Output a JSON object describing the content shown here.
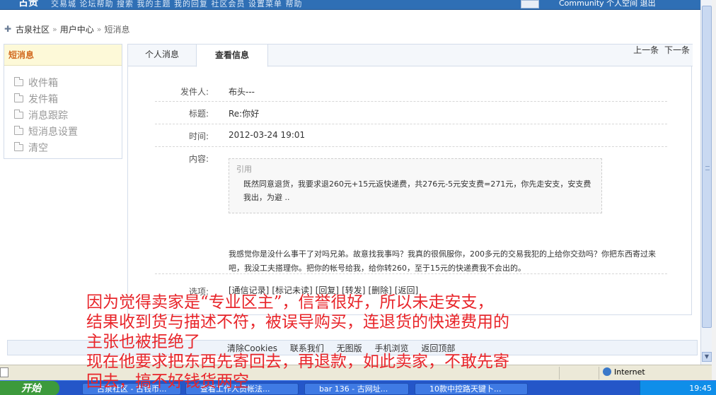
{
  "topbar": {
    "logo": "古贵",
    "nav_text": "交易城   论坛帮助   搜索   我的主题   我的回复   社区会员   设置菜单   帮助",
    "right_text": "Community   个人空间   退出"
  },
  "breadcrumb": {
    "items": [
      "古泉社区",
      "用户中心",
      "短消息"
    ]
  },
  "sidebar": {
    "title": "短消息",
    "items": [
      {
        "label": "收件箱",
        "icon": "folder-icon"
      },
      {
        "label": "发件箱",
        "icon": "folder-icon"
      },
      {
        "label": "消息跟踪",
        "icon": "folder-icon"
      },
      {
        "label": "短消息设置",
        "icon": "folder-icon"
      },
      {
        "label": "清空",
        "icon": "folder-icon"
      }
    ]
  },
  "tabs": [
    {
      "label": "个人消息",
      "active": false
    },
    {
      "label": "查看信息",
      "active": true
    }
  ],
  "pager": {
    "prev": "上一条",
    "next": "下一条"
  },
  "message": {
    "sender_label": "发件人:",
    "sender": "布头---",
    "subject_label": "标题:",
    "subject": "Re:你好",
    "time_label": "时间:",
    "time": "2012-03-24 19:01",
    "content_label": "内容:",
    "quote_title": "引用",
    "quote_body": "既然同意退货，我要求退260元+15元返快递费，共276元-5元安支费=271元，你先走安支，安支费我出，为避  ..",
    "body": "我感觉你是没什么事干了对吗兄弟。故意找我事吗？我真的很佩服你，200多元的交易我犯的上给你交劲吗？你把东西寄过来吧，我没工夫搭理你。把你的帐号给我，给你转260，至于15元的快递费我不会出的。",
    "options_label": "选项:",
    "options": [
      "[通信记录]",
      "[标记未读]",
      "[回复]",
      "[转发]",
      "[删除]",
      "[返回]"
    ]
  },
  "footer": {
    "links": [
      "清除Cookies",
      "联系我们",
      "无图版",
      "手机浏览",
      "返回顶部"
    ]
  },
  "statusbar": {
    "zone": "Internet"
  },
  "taskbar": {
    "start": "开始",
    "tasks": [
      "古泉社区 - 古钱币...",
      "查看工作人员帐法...",
      "bar 136 - 古网址...",
      "10款中控路天键卜..."
    ],
    "clock": "19:45"
  },
  "annotation": {
    "lines": [
      "因为觉得卖家是“专业区主”，信誉很好，所以未走安支，",
      "结果收到货与描述不符，被误导购买，连退货的快递费用的",
      "主张也被拒绝了",
      "现在他要求把东西先寄回去，再退款，如此卖家，不敢先寄",
      "回去，搞不好钱货两空"
    ],
    "color": "#e8252a"
  }
}
